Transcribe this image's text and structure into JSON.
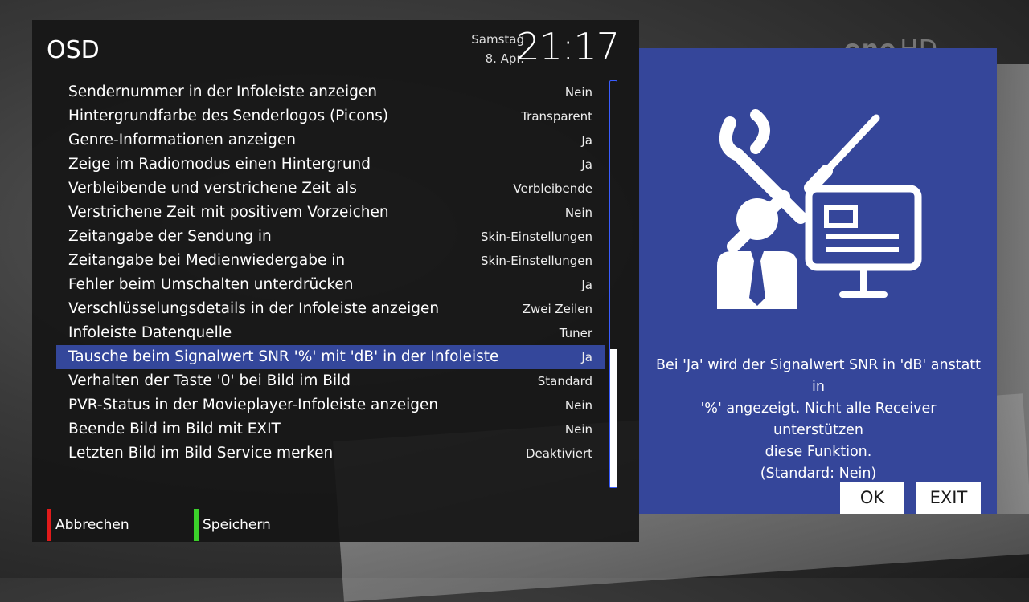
{
  "channel_logo": {
    "name": "one",
    "suffix": "HD"
  },
  "osd": {
    "title": "OSD",
    "date": {
      "weekday": "Samstag",
      "day": "8. Apr."
    },
    "time": "21:17",
    "items": [
      {
        "label": "Sendernummer in der Infoleiste anzeigen",
        "value": "Nein"
      },
      {
        "label": "Hintergrundfarbe des Senderlogos (Picons)",
        "value": "Transparent"
      },
      {
        "label": "Genre-Informationen anzeigen",
        "value": "Ja"
      },
      {
        "label": "Zeige im Radiomodus einen Hintergrund",
        "value": "Ja"
      },
      {
        "label": "Verbleibende und verstrichene Zeit als",
        "value": "Verbleibende"
      },
      {
        "label": "Verstrichene Zeit mit positivem Vorzeichen",
        "value": "Nein"
      },
      {
        "label": "Zeitangabe der Sendung in",
        "value": "Skin-Einstellungen"
      },
      {
        "label": "Zeitangabe bei Medienwiedergabe in",
        "value": "Skin-Einstellungen"
      },
      {
        "label": "Fehler beim Umschalten unterdrücken",
        "value": "Ja"
      },
      {
        "label": "Verschlüsselungsdetails in der Infoleiste anzeigen",
        "value": "Zwei Zeilen"
      },
      {
        "label": "Infoleiste Datenquelle",
        "value": "Tuner"
      },
      {
        "label": "Tausche beim Signalwert SNR '%' mit 'dB' in der Infoleiste",
        "value": "Ja"
      },
      {
        "label": "Verhalten der Taste '0' bei Bild im Bild",
        "value": "Standard"
      },
      {
        "label": "PVR-Status in der Movieplayer-Infoleiste anzeigen",
        "value": "Nein"
      },
      {
        "label": "Beende Bild im Bild mit EXIT",
        "value": "Nein"
      },
      {
        "label": "Letzten Bild im Bild Service merken",
        "value": "Deaktiviert"
      }
    ],
    "selected_index": 11,
    "scroll_fraction_visible": 0.34,
    "footer": {
      "red": {
        "label": "Abbrechen",
        "color": "#e01b1b"
      },
      "green": {
        "label": "Speichern",
        "color": "#3bd12a"
      }
    }
  },
  "help": {
    "lines": [
      "Bei 'Ja' wird der Signalwert SNR in 'dB' anstatt in",
      "'%' angezeigt. Nicht alle Receiver unterstützen",
      "diese Funktion.",
      "(Standard: Nein)"
    ],
    "ok_label": "OK",
    "exit_label": "EXIT",
    "accent_color": "#35469a"
  }
}
